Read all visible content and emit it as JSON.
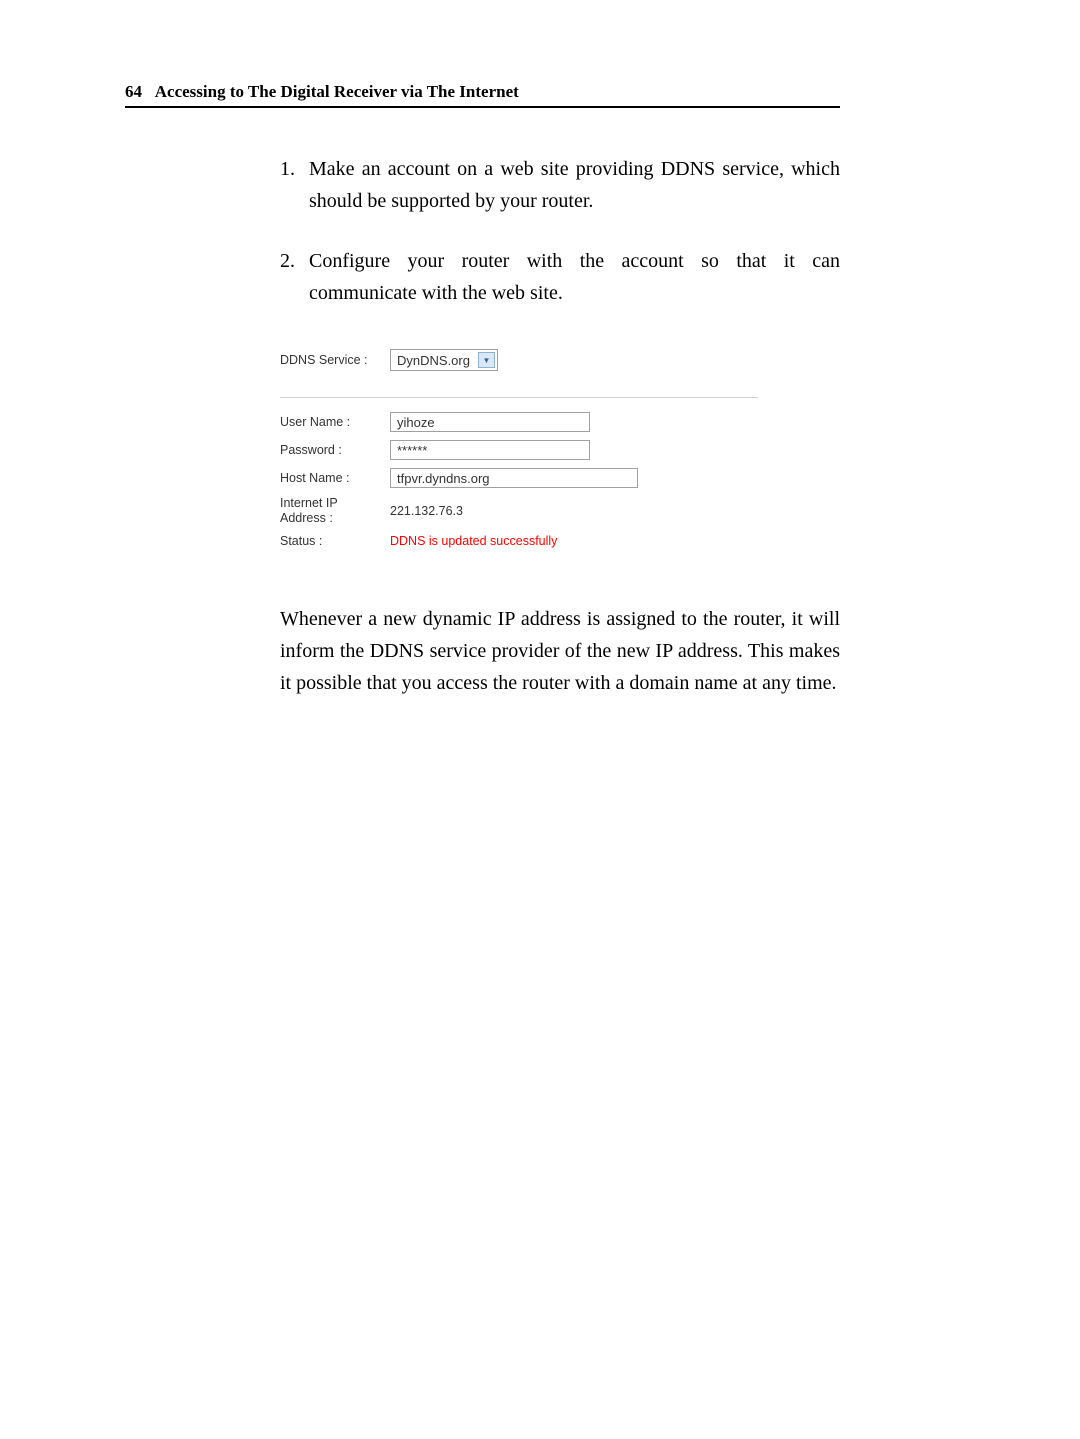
{
  "header": {
    "page_number": "64",
    "title": "Accessing to The Digital Receiver via The Internet"
  },
  "list": {
    "item1": {
      "number": "1.",
      "text": "Make an account on a web site providing DDNS service, which should be supported by your router."
    },
    "item2": {
      "number": "2.",
      "text": "Configure your router with the account so that it can communicate with the web site."
    }
  },
  "form": {
    "ddns_service_label": "DDNS Service :",
    "ddns_service_value": "DynDNS.org",
    "user_name_label": "User Name :",
    "user_name_value": "yihoze",
    "password_label": "Password :",
    "password_value": "******",
    "host_name_label": "Host Name :",
    "host_name_value": "tfpvr.dyndns.org",
    "ip_address_label_line1": "Internet IP",
    "ip_address_label_line2": "Address :",
    "ip_address_value": "221.132.76.3",
    "status_label": "Status :",
    "status_value": "DDNS is updated successfully"
  },
  "paragraph": {
    "text": "Whenever a new dynamic IP address is assigned to the router, it will inform the DDNS service provider of the new IP address. This makes it possible that you access the router with a domain name at any time."
  }
}
